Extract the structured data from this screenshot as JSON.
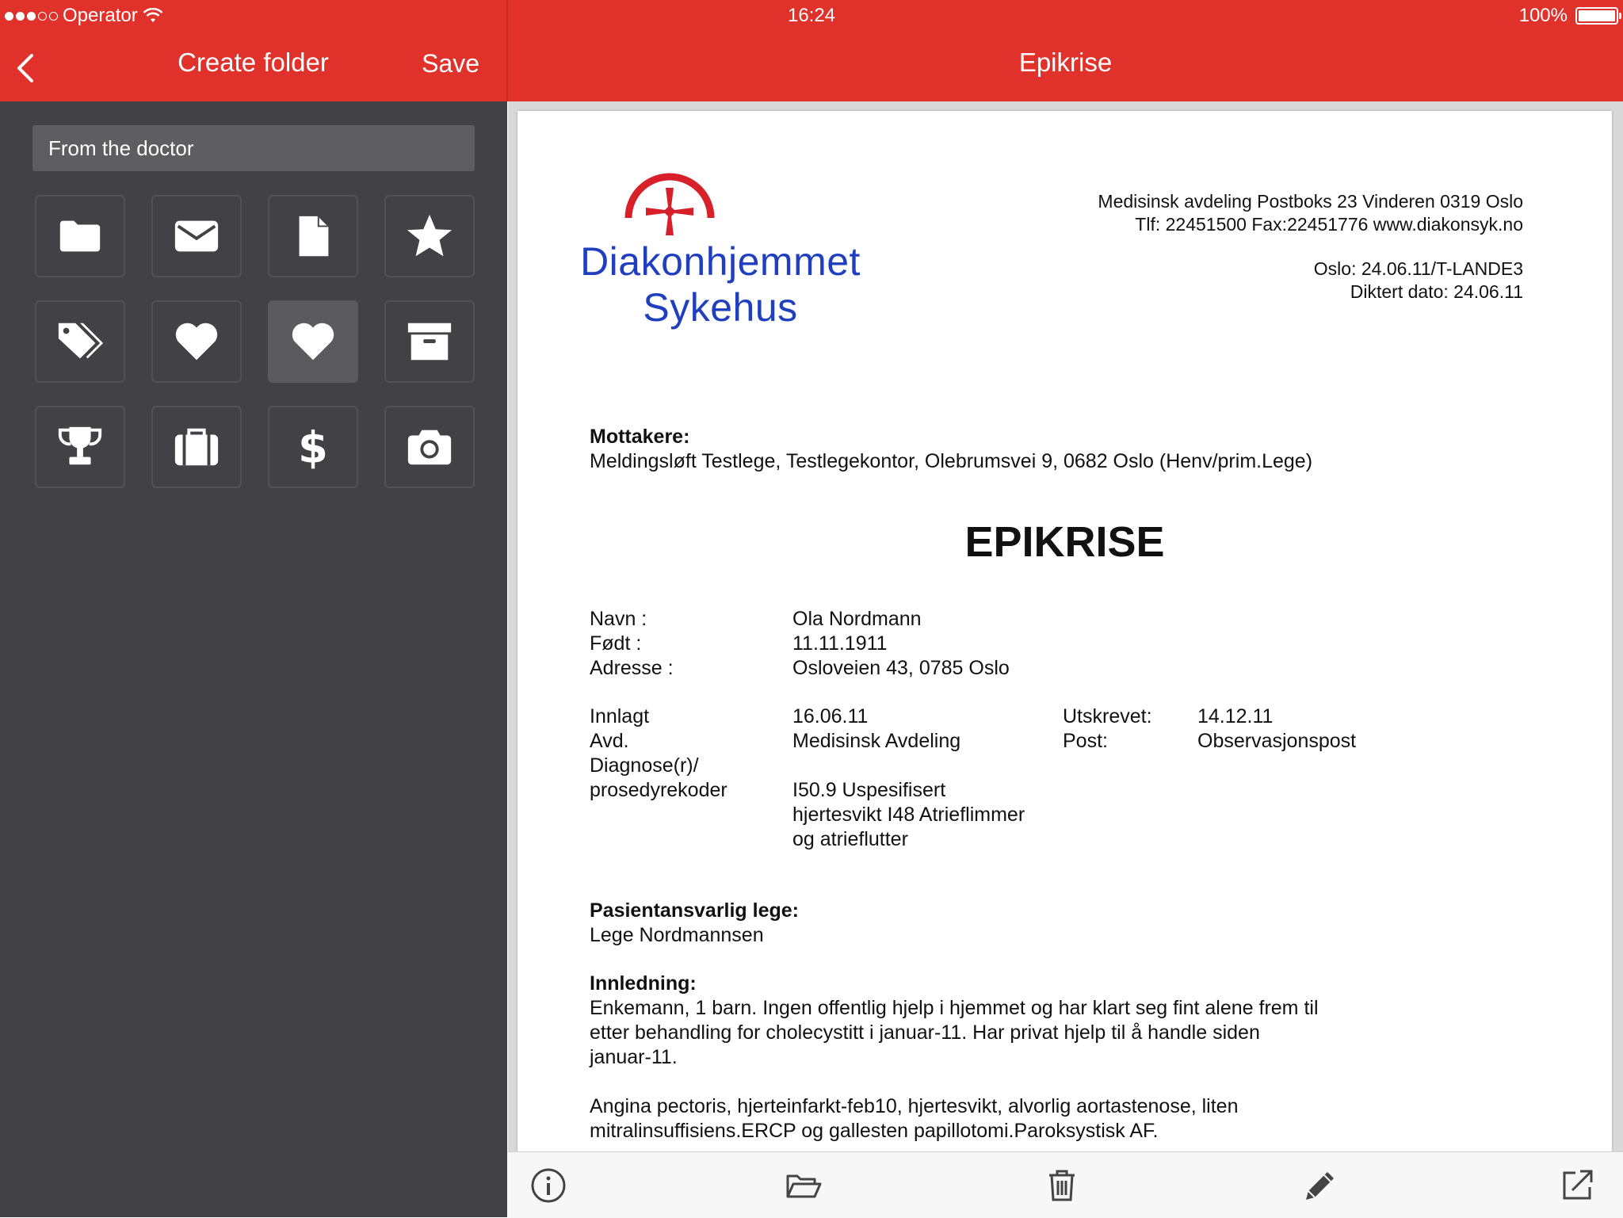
{
  "status_bar": {
    "carrier": "Operator",
    "time": "16:24",
    "battery": "100%",
    "signal_icon": "signal-dots-icon",
    "wifi_icon": "wifi-icon",
    "battery_icon": "battery-icon"
  },
  "left_nav": {
    "title": "Create folder",
    "save_label": "Save",
    "back_icon": "chevron-left-icon"
  },
  "right_nav": {
    "title": "Epikrise"
  },
  "folder_form": {
    "name_value": "From the doctor",
    "icons": [
      "folder-icon",
      "envelope-icon",
      "file-icon",
      "star-icon",
      "tags-icon",
      "heart-icon",
      "heart-icon",
      "archive-icon",
      "trophy-icon",
      "briefcase-icon",
      "dollar-icon",
      "camera-icon"
    ],
    "selected_index": 6
  },
  "colors": {
    "accent": "#e0312b",
    "panel": "#424246",
    "logo_blue": "#1f3fc0",
    "logo_red": "#d7202a"
  },
  "document": {
    "logo": {
      "line1": "Diakonhjemmet",
      "line2": "Sykehus"
    },
    "header": {
      "line1": "Medisinsk avdeling Postboks 23 Vinderen 0319 Oslo",
      "line2": "Tlf: 22451500 Fax:22451776 www.diakonsyk.no",
      "line3": "Oslo: 24.06.11/T-LANDE3",
      "line4": "Diktert dato: 24.06.11"
    },
    "recipients_label": "Mottakere:",
    "recipients": "Meldingsløft Testlege, Testlegekontor, Olebrumsvei 9, 0682 Oslo (Henv/prim.Lege)",
    "title": "EPIKRISE",
    "patient": {
      "name_label": "Navn :",
      "name": "Ola Nordmann",
      "born_label": "Født :",
      "born": "11.11.1911",
      "address_label": "Adresse :",
      "address": "Osloveien 43, 0785 Oslo"
    },
    "admission": {
      "admitted_label": "Innlagt",
      "admitted": "16.06.11",
      "discharged_label": "Utskrevet:",
      "discharged": "14.12.11",
      "dept_label": "Avd.",
      "dept": "Medisinsk Avdeling",
      "post_label": "Post:",
      "post": "Observasjonspost",
      "diag_label1": "Diagnose(r)/",
      "diag_label2": "prosedyrekoder",
      "diag1": "I50.9 Uspesifisert",
      "diag2": "hjertesvikt I48 Atrieflimmer",
      "diag3": "og atrieflutter"
    },
    "doctor_label": "Pasientansvarlig lege:",
    "doctor": "Lege Nordmannsen",
    "intro_label": "Innledning:",
    "intro1": "Enkemann, 1 barn. Ingen offentlig hjelp i hjemmet og har klart seg fint alene frem til",
    "intro2": "etter behandling for cholecystitt i januar-11. Har privat hjelp til å handle siden",
    "intro3": "januar-11.",
    "history1": "Angina pectoris, hjerteinfarkt-feb10, hjertesvikt, alvorlig aortastenose, liten",
    "history2": "mitralinsuffisiens.ERCP og gallesten papillotomi.Paroksystisk AF."
  },
  "toolbar": {
    "icons": [
      "info-icon",
      "folder-open-icon",
      "trash-icon",
      "pencil-icon",
      "share-icon"
    ]
  }
}
